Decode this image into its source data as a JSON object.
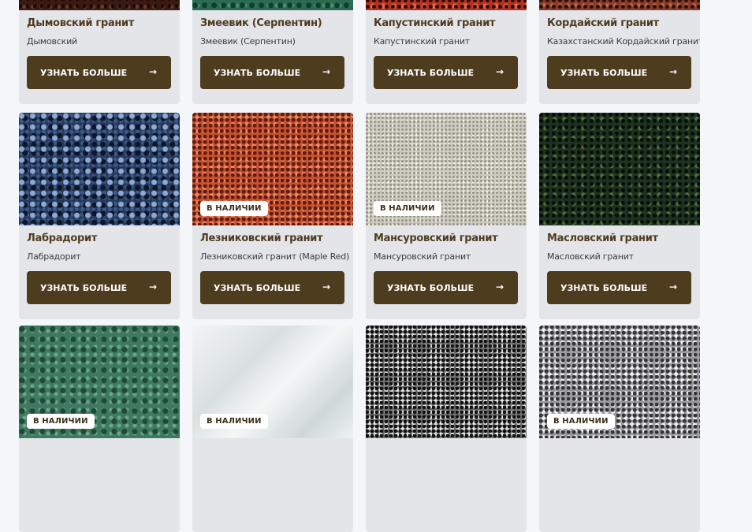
{
  "cards": [
    {
      "title": "Дымовский гранит",
      "subtitle": "Дымовский",
      "button_label": "УЗНАТЬ БОЛЬШЕ",
      "badge": "",
      "stone": "granite-dark-red-black"
    },
    {
      "title": "Змеевик (Серпентин)",
      "subtitle": "Змеевик (Серпентин)",
      "button_label": "УЗНАТЬ БОЛЬШЕ",
      "badge": "",
      "stone": "serpentine-green"
    },
    {
      "title": "Капустинский гранит",
      "subtitle": "Капустинский гранит",
      "button_label": "УЗНАТЬ БОЛЬШЕ",
      "badge": "",
      "stone": "granite-red"
    },
    {
      "title": "Кордайский гранит",
      "subtitle": "Казахстанский Кордайский гранит",
      "button_label": "УЗНАТЬ БОЛЬШЕ",
      "badge": "",
      "stone": "granite-brown-red"
    },
    {
      "title": "Лабрадорит",
      "subtitle": "Лабрадорит",
      "button_label": "УЗНАТЬ БОЛЬШЕ",
      "badge": "",
      "stone": "labradorite-blue"
    },
    {
      "title": "Лезниковский гранит",
      "subtitle": "Лезниковский гранит (Maple Red)",
      "button_label": "УЗНАТЬ БОЛЬШЕ",
      "badge": "В НАЛИЧИИ",
      "stone": "granite-orange-red"
    },
    {
      "title": "Мансуровский гранит",
      "subtitle": "Мансуровский гранит",
      "button_label": "УЗНАТЬ БОЛЬШЕ",
      "badge": "В НАЛИЧИИ",
      "stone": "granite-light-grey"
    },
    {
      "title": "Масловский гранит",
      "subtitle": "Масловский гранит",
      "button_label": "УЗНАТЬ БОЛЬШЕ",
      "badge": "",
      "stone": "granite-dark-green"
    },
    {
      "title": "",
      "subtitle": "",
      "button_label": "",
      "badge": "В НАЛИЧИИ",
      "stone": "marble-green"
    },
    {
      "title": "",
      "subtitle": "",
      "button_label": "",
      "badge": "В НАЛИЧИИ",
      "stone": "marble-white"
    },
    {
      "title": "",
      "subtitle": "",
      "button_label": "",
      "badge": "",
      "stone": "granite-black-white"
    },
    {
      "title": "",
      "subtitle": "",
      "button_label": "",
      "badge": "В НАЛИЧИИ",
      "stone": "granite-grey"
    }
  ],
  "colors": {
    "page_background": "#f5f6f9",
    "card_background": "#e4e5e9",
    "button_background": "#4e3c1f",
    "title_color": "#4e3b20"
  },
  "icons": {
    "button_arrow": "arrow-right-icon"
  }
}
